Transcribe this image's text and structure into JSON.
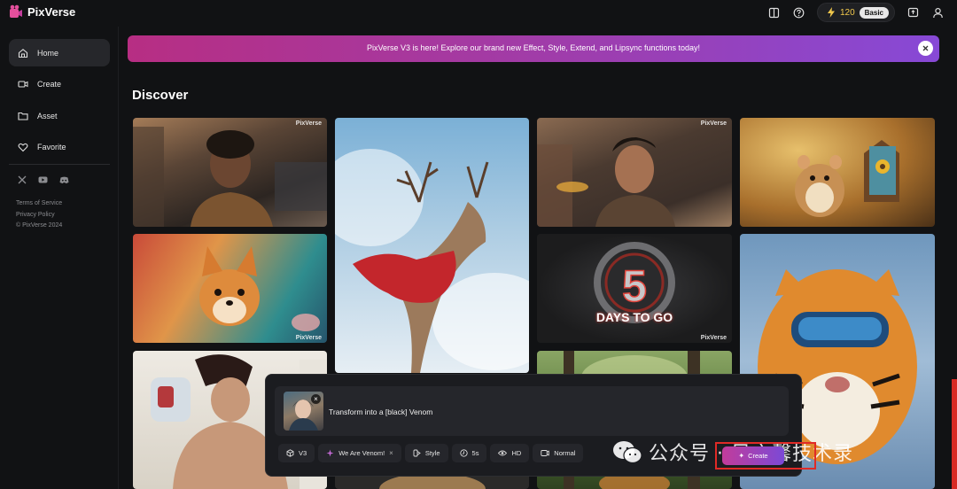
{
  "app": {
    "name": "PixVerse"
  },
  "header": {
    "icons": [
      "book-icon",
      "help-icon",
      "bolt-icon",
      "upload-icon",
      "user-icon"
    ],
    "credits": "120",
    "plan": "Basic"
  },
  "sidebar": {
    "items": [
      {
        "label": "Home",
        "icon": "home-icon"
      },
      {
        "label": "Create",
        "icon": "video-camera-icon"
      },
      {
        "label": "Asset",
        "icon": "folder-icon"
      },
      {
        "label": "Favorite",
        "icon": "heart-icon"
      }
    ],
    "social": [
      "x-icon",
      "youtube-icon",
      "discord-icon"
    ],
    "footer": {
      "terms": "Terms of Service",
      "privacy": "Privacy Policy",
      "copyright": "© PixVerse 2024"
    }
  },
  "banner": {
    "text": "PixVerse V3 is here! Explore our brand new Effect, Style, Extend, and Lipsync functions today!"
  },
  "discover": {
    "title": "Discover",
    "watermark": "PixVerse",
    "tile_text": "DAYS TO GO"
  },
  "prompt": {
    "text": "Transform into a [black] Venom",
    "options": [
      {
        "label": "V3",
        "icon": "cube-icon"
      },
      {
        "label": "We Are Venom!",
        "icon": "sparkle-icon"
      },
      {
        "label": "Style",
        "icon": "style-icon"
      },
      {
        "label": "5s",
        "icon": "clock-icon"
      },
      {
        "label": "HD",
        "icon": "eye-icon"
      },
      {
        "label": "Normal",
        "icon": "motion-icon"
      }
    ],
    "create_label": "Create"
  },
  "overlay": {
    "wechat_text": "公众号 · 风之馨技术录"
  },
  "colors": {
    "accent": "#b72e83",
    "accent2": "#8749d6",
    "background": "#111214",
    "highlight": "#e02a26"
  }
}
